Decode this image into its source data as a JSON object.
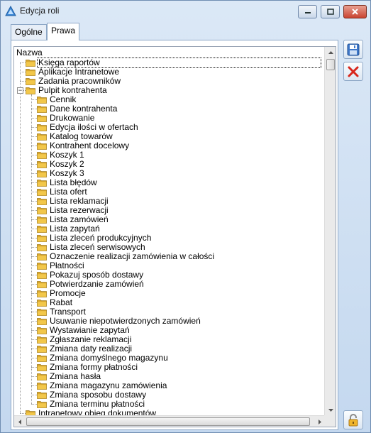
{
  "window": {
    "title": "Edycja roli"
  },
  "tabs": [
    {
      "label": "Ogólne",
      "active": false
    },
    {
      "label": "Prawa",
      "active": true
    }
  ],
  "tree": {
    "header": "Nazwa",
    "items": [
      {
        "label": "Księga raportów",
        "level": 0,
        "selected": true
      },
      {
        "label": "Aplikacje Intranetowe",
        "level": 0
      },
      {
        "label": "Zadania pracowników",
        "level": 0
      },
      {
        "label": "Pulpit kontrahenta",
        "level": 0,
        "expanded": true
      },
      {
        "label": "Cennik",
        "level": 1
      },
      {
        "label": "Dane kontrahenta",
        "level": 1
      },
      {
        "label": "Drukowanie",
        "level": 1
      },
      {
        "label": "Edycja ilości w ofertach",
        "level": 1
      },
      {
        "label": "Katalog towarów",
        "level": 1
      },
      {
        "label": "Kontrahent docelowy",
        "level": 1
      },
      {
        "label": "Koszyk 1",
        "level": 1
      },
      {
        "label": "Koszyk 2",
        "level": 1
      },
      {
        "label": "Koszyk 3",
        "level": 1
      },
      {
        "label": "Lista błędów",
        "level": 1
      },
      {
        "label": "Lista ofert",
        "level": 1
      },
      {
        "label": "Lista reklamacji",
        "level": 1
      },
      {
        "label": "Lista rezerwacji",
        "level": 1
      },
      {
        "label": "Lista zamówień",
        "level": 1
      },
      {
        "label": "Lista zapytań",
        "level": 1
      },
      {
        "label": "Lista zleceń produkcyjnych",
        "level": 1
      },
      {
        "label": "Lista zleceń serwisowych",
        "level": 1
      },
      {
        "label": "Oznaczenie realizacji zamówienia w całości",
        "level": 1
      },
      {
        "label": "Płatności",
        "level": 1
      },
      {
        "label": "Pokazuj sposób dostawy",
        "level": 1
      },
      {
        "label": "Potwierdzanie zamówień",
        "level": 1
      },
      {
        "label": "Promocje",
        "level": 1
      },
      {
        "label": "Rabat",
        "level": 1
      },
      {
        "label": "Transport",
        "level": 1
      },
      {
        "label": "Usuwanie niepotwierdzonych zamówień",
        "level": 1
      },
      {
        "label": "Wystawianie zapytań",
        "level": 1
      },
      {
        "label": "Zgłaszanie reklamacji",
        "level": 1
      },
      {
        "label": "Zmiana daty realizacji",
        "level": 1
      },
      {
        "label": "Zmiana domyślnego magazynu",
        "level": 1
      },
      {
        "label": "Zmiana formy płatności",
        "level": 1
      },
      {
        "label": "Zmiana hasła",
        "level": 1
      },
      {
        "label": "Zmiana magazynu zamówienia",
        "level": 1
      },
      {
        "label": "Zmiana sposobu dostawy",
        "level": 1
      },
      {
        "label": "Zmiana terminu płatności",
        "level": 1
      },
      {
        "label": "Intranetowy obieg dokumentów",
        "level": 0
      }
    ]
  },
  "actions": {
    "save_icon": "floppy-disk-icon",
    "cancel_icon": "red-x-icon",
    "lock_icon": "padlock-icon"
  },
  "colors": {
    "folder": "#f2c74a",
    "window_bg": "#d3e2f3",
    "close_button": "#c94431"
  }
}
